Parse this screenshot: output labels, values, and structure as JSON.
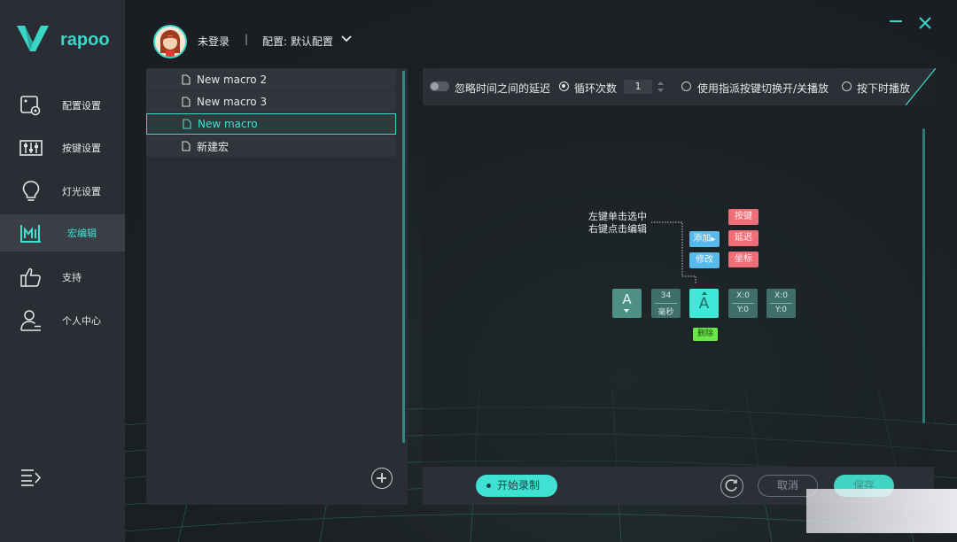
{
  "brand": {
    "name": "rapoo"
  },
  "sidebar": {
    "items": [
      {
        "label": "配置设置",
        "icon": "config-icon"
      },
      {
        "label": "按键设置",
        "icon": "sliders-icon"
      },
      {
        "label": "灯光设置",
        "icon": "bulb-icon"
      },
      {
        "label": "宏编辑",
        "icon": "macro-icon",
        "active": true
      },
      {
        "label": "支持",
        "icon": "thumbs-up-icon"
      },
      {
        "label": "个人中心",
        "icon": "user-icon"
      }
    ]
  },
  "header": {
    "user": "未登录",
    "separator": "|",
    "profile": "配置: 默认配置"
  },
  "macros": {
    "items": [
      {
        "name": "New macro 2"
      },
      {
        "name": "New macro 3"
      },
      {
        "name": "New macro",
        "selected": true
      },
      {
        "name": "新建宏"
      }
    ]
  },
  "toolbar": {
    "ignore_delay": "忽略时间之间的延迟",
    "loop_count_label": "循环次数",
    "loop_count_value": "1",
    "toggle_by_key": "使用指派按键切换开/关播放",
    "play_while_pressed": "按下时播放"
  },
  "hint": {
    "line1": "左键单击选中",
    "line2": "右键点击编辑"
  },
  "context": {
    "add": "添加",
    "modify": "修改",
    "key": "按键",
    "delay": "延迟",
    "coord": "坐标"
  },
  "nodes": {
    "key1": "A",
    "delay_value": "34",
    "delay_unit": "毫秒",
    "key2": "A",
    "coord1_x": "X:0",
    "coord1_y": "Y:0",
    "coord2_x": "X:0",
    "coord2_y": "Y:0",
    "delete": "删除"
  },
  "bottom": {
    "record": "开始录制",
    "cancel": "取消",
    "save": "保存"
  },
  "colors": {
    "accent": "#3fe2d2",
    "sidebar_bg": "#2a2e34",
    "blue": "#58b9ec",
    "red": "#ee6f78",
    "green": "#6ae84a"
  }
}
